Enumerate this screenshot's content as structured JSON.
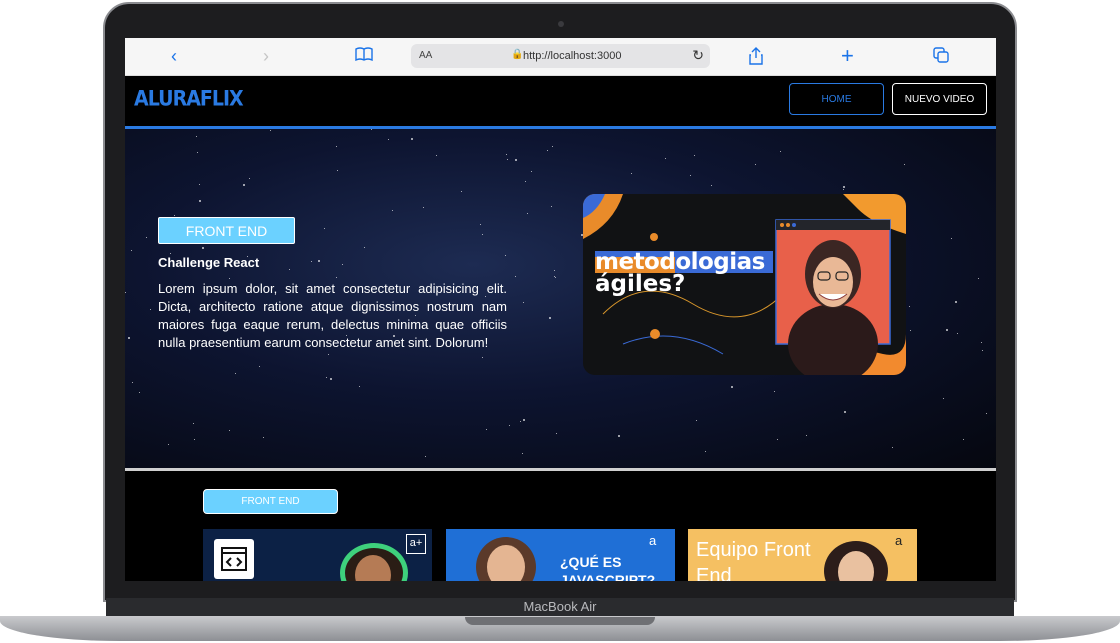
{
  "device": {
    "brand": "MacBook Air"
  },
  "browser": {
    "address": "http://localhost:3000",
    "aa": "AA"
  },
  "nav": {
    "logo": "ALURAFLIX",
    "home": "HOME",
    "new_video": "NUEVO VIDEO"
  },
  "hero": {
    "category": "FRONT END",
    "title": "Challenge React",
    "description": "Lorem ipsum dolor, sit amet consectetur adipisicing elit. Dicta, architecto ratione atque dignissimos nostrum nam maiores fuga eaque rerum, delectus minima quae officiis nulla praesentium earum consectetur amet sint. Dolorum!",
    "thumb_line1": "metodologias",
    "thumb_line2": "ágiles?"
  },
  "section": {
    "category": "FRONT END"
  },
  "cards": [
    {
      "caption": ""
    },
    {
      "caption": "¿QUÉ ES JAVASCRIPT?"
    },
    {
      "caption": "Equipo Front End"
    }
  ],
  "colors": {
    "accent": "#2a7ae2",
    "category": "#6bd1ff",
    "background": "#000000"
  }
}
